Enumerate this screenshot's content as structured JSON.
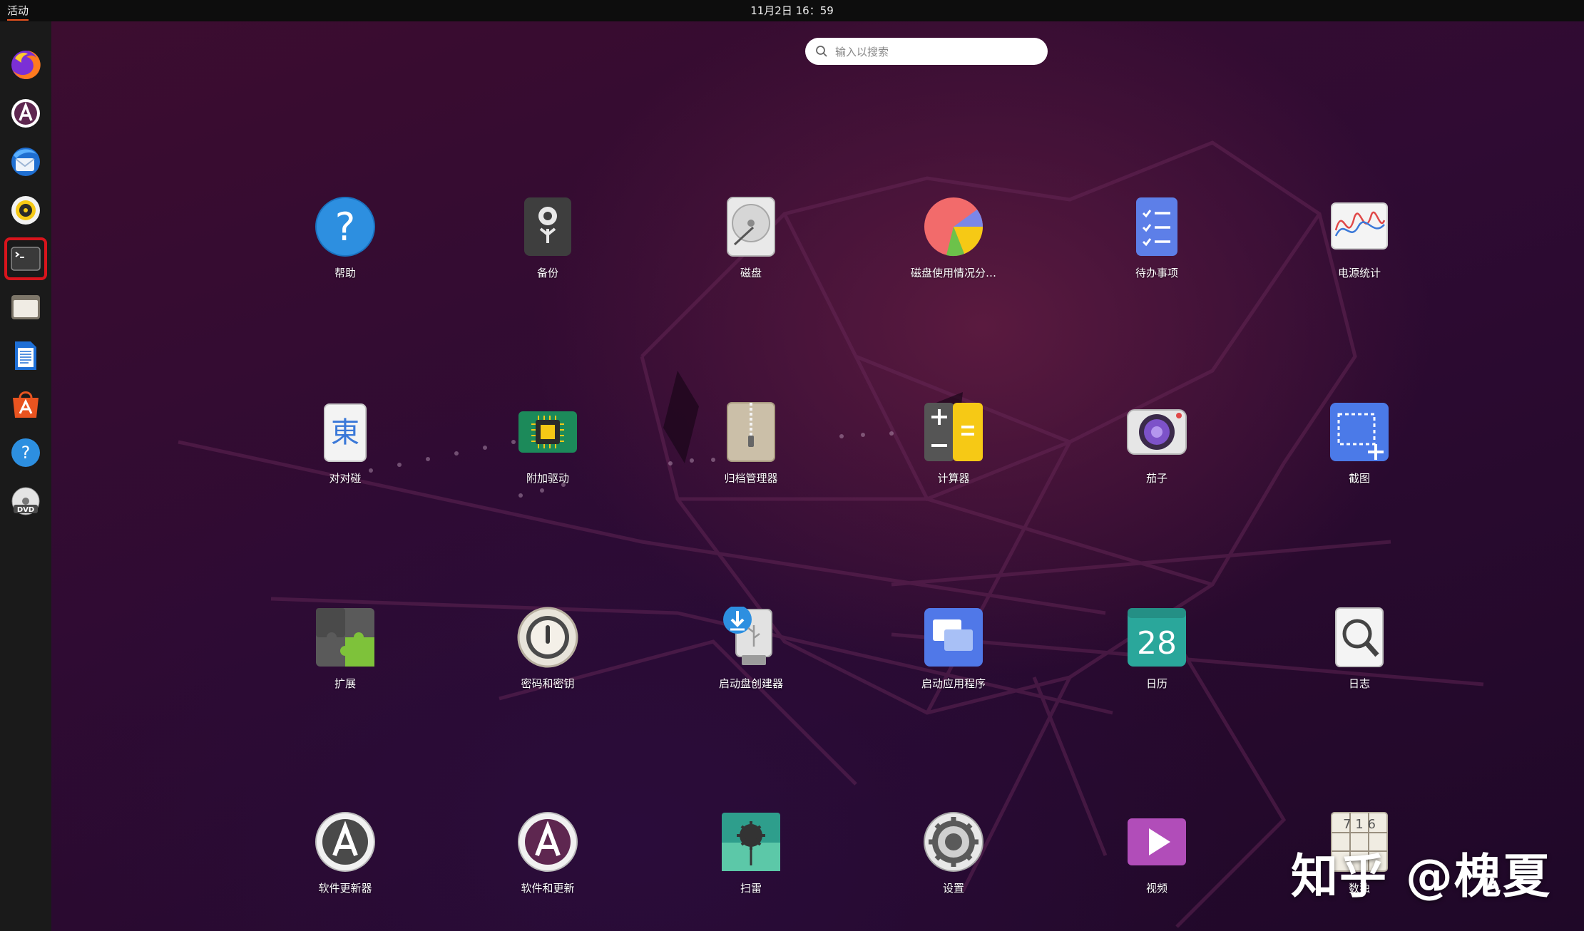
{
  "topbar": {
    "activities": "活动",
    "clock": "11月2日 16：59"
  },
  "search": {
    "placeholder": "输入以搜索"
  },
  "dock": {
    "items": [
      "firefox",
      "app-center",
      "thunderbird",
      "rhythmbox",
      "terminal",
      "files",
      "writer",
      "software",
      "help",
      "dvd"
    ],
    "selected": "terminal"
  },
  "apps": [
    {
      "label": "帮助",
      "icon": "help-icon"
    },
    {
      "label": "备份",
      "icon": "backup-icon"
    },
    {
      "label": "磁盘",
      "icon": "disks-icon"
    },
    {
      "label": "磁盘使用情况分…",
      "icon": "disk-usage-icon"
    },
    {
      "label": "待办事项",
      "icon": "todo-icon"
    },
    {
      "label": "电源统计",
      "icon": "power-stats-icon"
    },
    {
      "label": "对对碰",
      "icon": "mahjongg-icon",
      "glyph": "東"
    },
    {
      "label": "附加驱动",
      "icon": "drivers-icon"
    },
    {
      "label": "归档管理器",
      "icon": "archive-icon"
    },
    {
      "label": "计算器",
      "icon": "calculator-icon"
    },
    {
      "label": "茄子",
      "icon": "cheese-icon"
    },
    {
      "label": "截图",
      "icon": "screenshot-icon"
    },
    {
      "label": "扩展",
      "icon": "extensions-icon"
    },
    {
      "label": "密码和密钥",
      "icon": "passwords-icon"
    },
    {
      "label": "启动盘创建器",
      "icon": "usb-creator-icon"
    },
    {
      "label": "启动应用程序",
      "icon": "startup-apps-icon"
    },
    {
      "label": "日历",
      "icon": "calendar-icon",
      "glyph": "28"
    },
    {
      "label": "日志",
      "icon": "logs-icon"
    },
    {
      "label": "软件更新器",
      "icon": "software-updater-icon"
    },
    {
      "label": "软件和更新",
      "icon": "software-updates-icon"
    },
    {
      "label": "扫雷",
      "icon": "mines-icon"
    },
    {
      "label": "设置",
      "icon": "settings-icon"
    },
    {
      "label": "视频",
      "icon": "videos-icon"
    },
    {
      "label": "数独",
      "icon": "sudoku-icon",
      "glyph": "7 1 6"
    }
  ],
  "watermark": "知乎 @槐夏"
}
